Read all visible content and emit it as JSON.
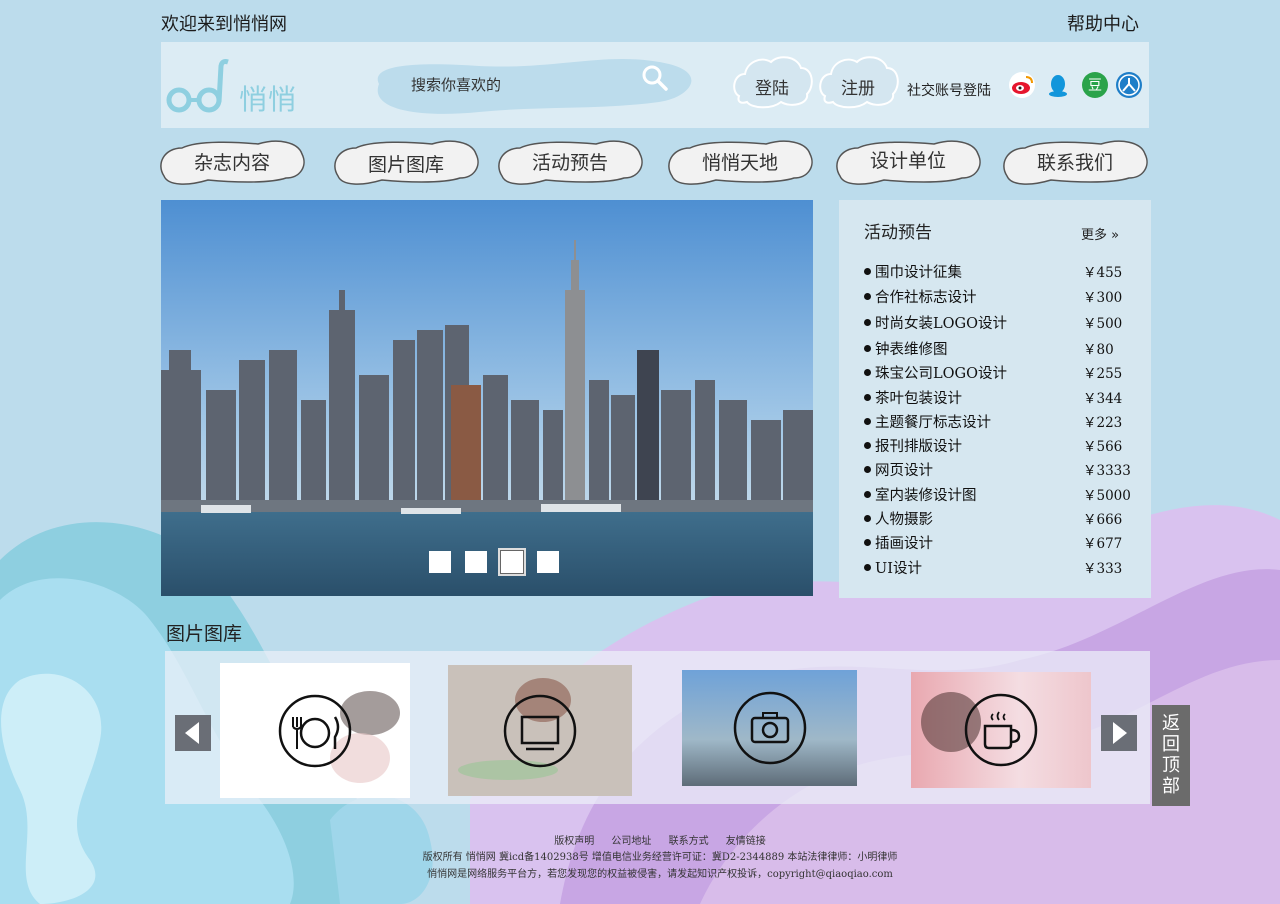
{
  "topbar": {
    "welcome": "欢迎来到悄悄网",
    "help": "帮助中心"
  },
  "header": {
    "logo_text": "悄悄",
    "search_placeholder": "搜索你喜欢的",
    "login": "登陆",
    "register": "注册",
    "social_label": "社交账号登陆",
    "social_icons": [
      "weibo-icon",
      "qq-icon",
      "douban-icon",
      "renren-icon"
    ]
  },
  "nav": [
    "杂志内容",
    "图片图库",
    "活动预告",
    "悄悄天地",
    "设计单位",
    "联系我们"
  ],
  "carousel": {
    "slides": 4,
    "active_index": 2
  },
  "events": {
    "title": "活动预告",
    "more": "更多",
    "items": [
      {
        "name": "围巾设计征集",
        "price": "￥455"
      },
      {
        "name": "合作社标志设计",
        "price": "￥300"
      },
      {
        "name": "时尚女装LOGO设计",
        "price": "￥500"
      },
      {
        "name": "钟表维修图",
        "price": "￥80"
      },
      {
        "name": "珠宝公司LOGO设计",
        "price": "￥255"
      },
      {
        "name": "茶叶包装设计",
        "price": "￥344"
      },
      {
        "name": "主题餐厅标志设计",
        "price": "￥223"
      },
      {
        "name": "报刊排版设计",
        "price": "￥566"
      },
      {
        "name": "网页设计",
        "price": "￥3333"
      },
      {
        "name": "室内装修设计图",
        "price": "￥5000"
      },
      {
        "name": "人物摄影",
        "price": "￥666"
      },
      {
        "name": "插画设计",
        "price": "￥677"
      },
      {
        "name": "UI设计",
        "price": "￥333"
      }
    ]
  },
  "gallery": {
    "title": "图片图库",
    "items": [
      "food-icon",
      "tv-icon",
      "camera-icon",
      "coffee-icon"
    ]
  },
  "backtop": "返回顶部",
  "footer": {
    "links": [
      "版权声明",
      "公司地址",
      "联系方式",
      "友情链接"
    ],
    "line2": "版权所有 悄悄网 冀icd备1402938号 增值电信业务经营许可证：冀D2-2344889 本站法律律师：小明律师",
    "line3": "悄悄网是网络服务平台方，若您发现您的权益被侵害，请发起知识产权投诉，copyright@qiaoqiao.com"
  },
  "colors": {
    "background": "#bcdcec",
    "panel": "#d6e7f0",
    "accent": "#8ecfe0",
    "purple": "#c8a6e4"
  }
}
